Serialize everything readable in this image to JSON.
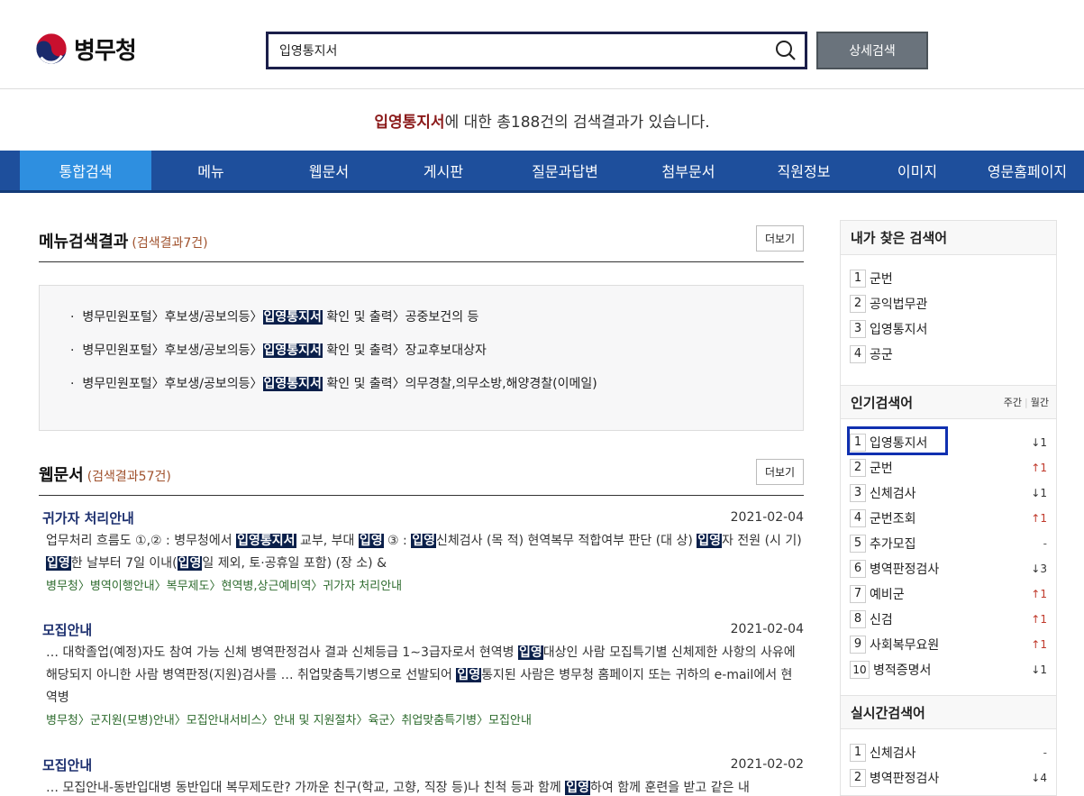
{
  "header": {
    "logo_text": "병무청",
    "search_value": "입영통지서",
    "search_icon": "search-icon",
    "advanced_search_label": "상세검색"
  },
  "summary": {
    "keyword": "입영통지서",
    "text": "에 대한 총188건의 검색결과가 있습니다."
  },
  "nav": {
    "tabs": [
      "통합검색",
      "메뉴",
      "웹문서",
      "게시판",
      "질문과답변",
      "첨부문서",
      "직원정보",
      "이미지",
      "영문홈페이지"
    ],
    "active": "통합검색"
  },
  "menu_section": {
    "title": "메뉴검색결과",
    "count": "(검색결과7건)",
    "more": "더보기",
    "items": [
      {
        "before": "병무민원포털〉후보생/공보의등〉",
        "hl": "입영통지서",
        "after": " 확인 및 출력〉공중보건의 등"
      },
      {
        "before": "병무민원포털〉후보생/공보의등〉",
        "hl": "입영통지서",
        "after": " 확인 및 출력〉장교후보대상자"
      },
      {
        "before": "병무민원포털〉후보생/공보의등〉",
        "hl": "입영통지서",
        "after": " 확인 및 출력〉의무경찰,의무소방,해양경찰(이메일)"
      }
    ]
  },
  "web_section": {
    "title": "웹문서",
    "count": "(검색결과57건)",
    "more": "더보기",
    "docs": [
      {
        "title": "귀가자 처리안내",
        "date": "2021-02-04",
        "path": "병무청〉병역이행안내〉복무제도〉현역병,상근예비역〉귀가자 처리안내"
      },
      {
        "title": "모집안내",
        "date": "2021-02-04",
        "path": "병무청〉군지원(모병)안내〉모집안내서비스〉안내 및 지원절차〉육군〉취업맞춤특기병〉모집안내"
      },
      {
        "title": "모집안내",
        "date": "2021-02-02"
      }
    ]
  },
  "sidebar": {
    "my_searches": {
      "title": "내가 찾은 검색어",
      "items": [
        "군번",
        "공익법무관",
        "입영통지서",
        "공군"
      ]
    },
    "popular": {
      "title": "인기검색어",
      "weekly": "주간",
      "monthly": "월간",
      "items": [
        {
          "rank": "1",
          "term": "입영통지서",
          "dir": "down",
          "change": "1"
        },
        {
          "rank": "2",
          "term": "군번",
          "dir": "up",
          "change": "1"
        },
        {
          "rank": "3",
          "term": "신체검사",
          "dir": "down",
          "change": "1"
        },
        {
          "rank": "4",
          "term": "군번조회",
          "dir": "up",
          "change": "1"
        },
        {
          "rank": "5",
          "term": "추가모집",
          "dir": "flat",
          "change": "-"
        },
        {
          "rank": "6",
          "term": "병역판정검사",
          "dir": "down",
          "change": "3"
        },
        {
          "rank": "7",
          "term": "예비군",
          "dir": "up",
          "change": "1"
        },
        {
          "rank": "8",
          "term": "신검",
          "dir": "up",
          "change": "1"
        },
        {
          "rank": "9",
          "term": "사회복무요원",
          "dir": "up",
          "change": "1"
        },
        {
          "rank": "10",
          "term": "병적증명서",
          "dir": "down",
          "change": "1"
        }
      ]
    },
    "realtime": {
      "title": "실시간검색어",
      "items": [
        {
          "rank": "1",
          "term": "신체검사",
          "dir": "flat",
          "change": "-"
        },
        {
          "rank": "2",
          "term": "병역판정검사",
          "dir": "down",
          "change": "4"
        }
      ]
    }
  }
}
